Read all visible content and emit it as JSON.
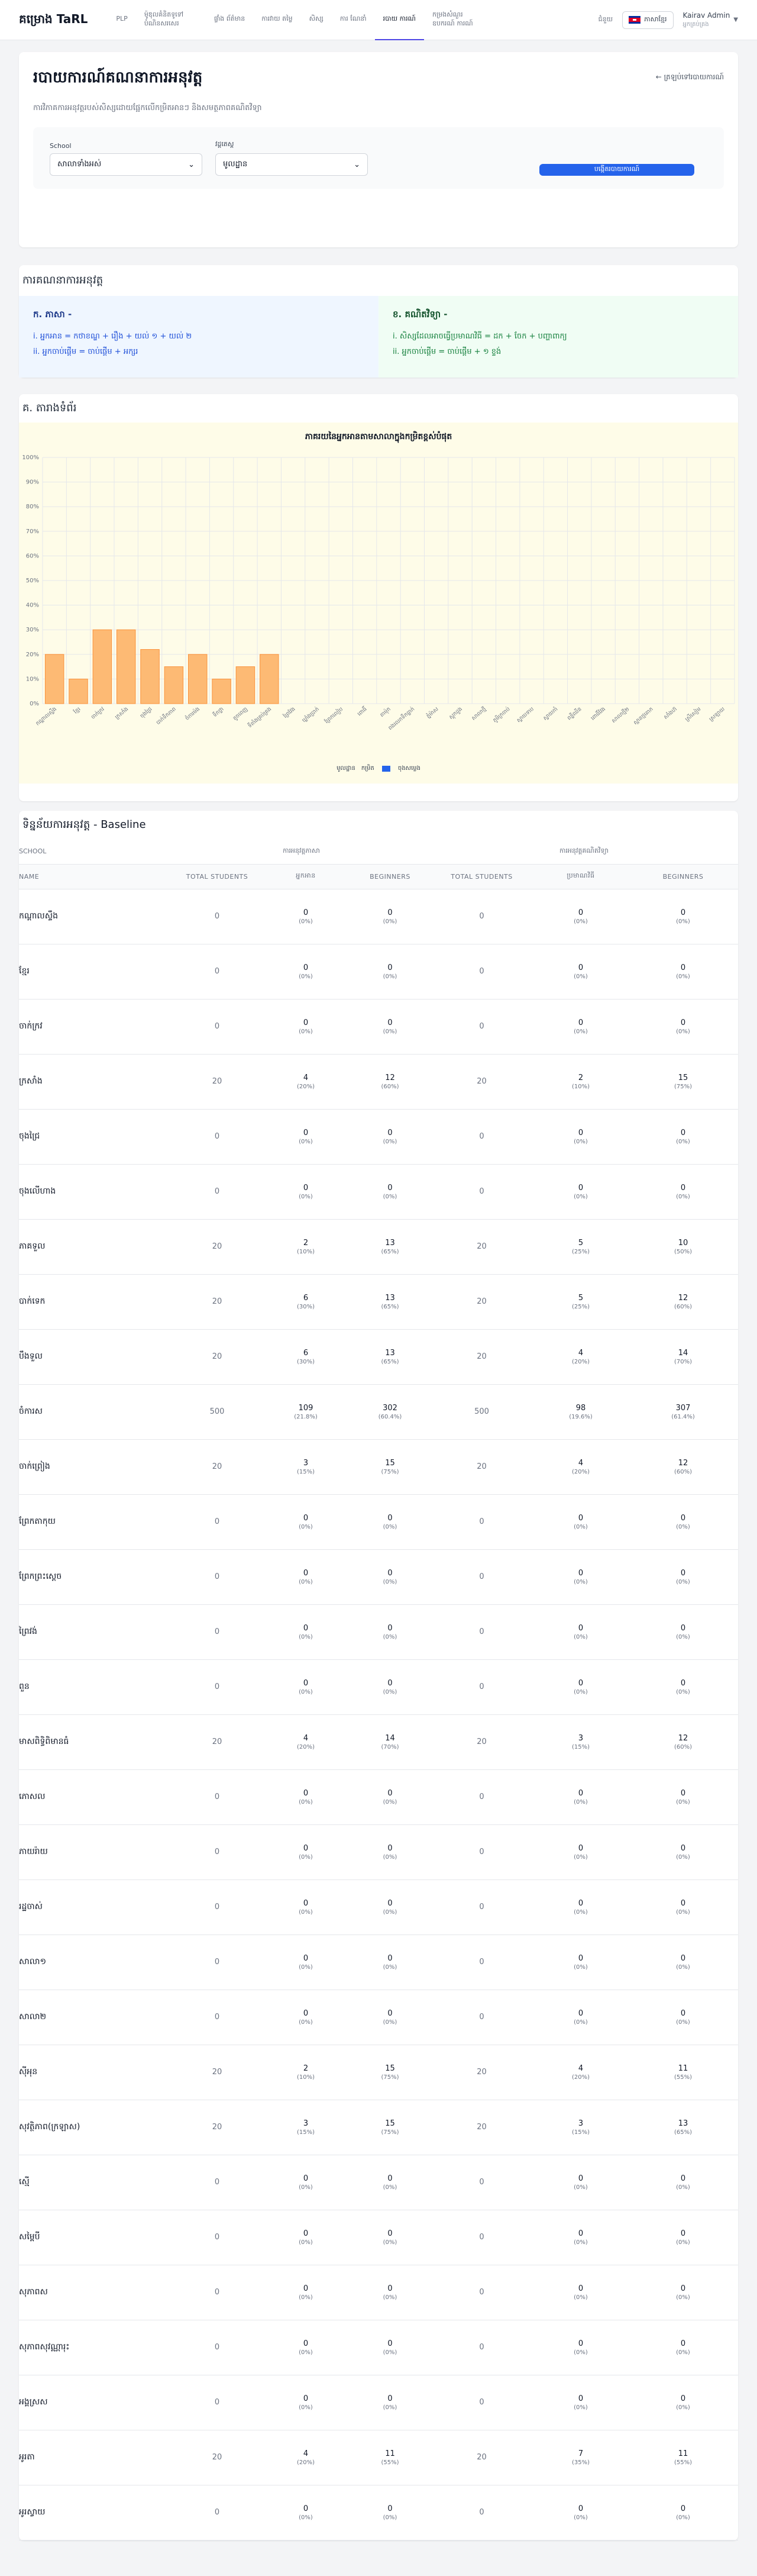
{
  "nav": {
    "brand": "គម្រោង TaRL",
    "links": [
      {
        "label": "PLP",
        "active": false
      },
      {
        "label": "ម៉ូឌុលគំនិតទូទៅ បំណិនសរសេរ",
        "active": false
      },
      {
        "label": "ផ្ទាំង ព័ត៌មាន",
        "active": false
      },
      {
        "label": "ការវាយ តម្លៃ",
        "active": false
      },
      {
        "label": "សិស្ស",
        "active": false
      },
      {
        "label": "ការ ណែនាំ",
        "active": false
      },
      {
        "label": "របាយ ការណ៍",
        "active": true
      },
      {
        "label": "កម្រងសំណួរ ឧបករណ៍ ការណ៍",
        "active": false
      },
      {
        "label": "ជំនួយ",
        "active": false
      }
    ],
    "language": "ភាសាខ្មែរ",
    "user_name": "Kairav Admin",
    "user_role": "អ្នកគ្រប់គ្រង"
  },
  "header": {
    "title": "របាយការណ៍គណនាការអនុវត្ត",
    "back_link": "← ត្រឡប់ទៅរបាយការណ៍",
    "subtitle": "ការវិភាគការអនុវត្តរបស់សិស្សដោយផ្អែកលើកម្រិតអានៗ និងសមត្ថភាពគណិតវិទ្យា",
    "filters": {
      "school_label": "School",
      "school_value": "សាលាទាំងអស់",
      "cycle_label": "វដ្តតេស្ត",
      "cycle_value": "មូលដ្ឋាន",
      "submit_label": "បង្កើតរបាយការណ៍"
    }
  },
  "assessment": {
    "section_title": "ការគណនាការអនុវត្ត",
    "left": {
      "title": "ក. ភាសា -",
      "items": [
        "i. អ្នកអាន = កថាខណ្ឌ + រឿង + យល់ ១ + យល់ ២",
        "ii. អ្នកចាប់ផ្តើម = ចាប់ផ្តើម + អក្សរ"
      ]
    },
    "right": {
      "title": "ខ. គណិតវិទ្យា -",
      "items": [
        "i. សិស្សដែលអាចធ្វើប្រមាណវិធី = ដក + ចែក + បញ្ហាពាក្យ",
        "ii. អ្នកចាប់ផ្តើម = ចាប់ផ្តើម + ១ ខ្ទង់"
      ]
    }
  },
  "chart_section_title": "គ. តារាងទំព័រ",
  "chart_data": {
    "type": "bar",
    "title": "ភាគរយនៃអ្នកអានតាមសាលាក្នុងកម្រិតខ្ពស់បំផុត",
    "categories": [
      "កណ្តាលស្ទឹង",
      "ខ្មែរ",
      "ចាក់ក្រវ",
      "ក្រសាំង",
      "ចុងជ្រៃ",
      "បាក់ទឹកភាព",
      "ចំការម៉ង",
      "ទឹកថ្លា",
      "តូចពេញ",
      "ទីតាំងគ្រប់គ្រង",
      "ព្រៃវែង",
      "ឃ្លាំងប្រាក់",
      "ព្រែកលៀប",
      "ពោធិ៍",
      "តាម៉ុក",
      "ពងរលកទឹកធ្លាក់",
      "ភ្នំម៉ាស",
      "ស្តុកដួង",
      "សាលាថ្មី",
      "ភូមិក្រចាប់",
      "ស្វាយទាប",
      "ស្វាយកាំ",
      "ពន្លឺឈឺន",
      "ពោធិ៍វែង",
      "សាលាថ្មី២",
      "ស្ពានថ្មគោក",
      "សាំងហ៊",
      "ស្រីសៀម",
      "ស្រឡាយ"
    ],
    "values": [
      20,
      10,
      30,
      30,
      22,
      15,
      20,
      10,
      15,
      20,
      0,
      0,
      0,
      0,
      0,
      0,
      0,
      0,
      0,
      0,
      0,
      0,
      0,
      0,
      0,
      0,
      0,
      0,
      0
    ],
    "ylim": [
      0,
      100
    ],
    "yticks": [
      "0%",
      "10%",
      "20%",
      "30%",
      "40%",
      "50%",
      "60%",
      "70%",
      "80%",
      "90%",
      "100%"
    ],
    "grid": true,
    "colors": {
      "bar": "#fdba74",
      "bar_border": "#fb923c",
      "legend2": "#2563eb"
    },
    "legend": [
      "មូលដ្ឋាន",
      "កម្រិត",
      "ចុងសម្លេង"
    ]
  },
  "table": {
    "title": "ទិន្នន័យការអនុវត្ត - Baseline",
    "group_headers": {
      "school": "SCHOOL",
      "khmer": "ការអនុវត្តភាសា",
      "math": "ការអនុវត្តគណិតវិទ្យា"
    },
    "headers": {
      "name": "NAME",
      "total1": "TOTAL STUDENTS",
      "readers": "អ្នកអាន",
      "beginners1": "BEGINNERS",
      "total2": "TOTAL STUDENTS",
      "math_cap": "ប្រមាណវិធី",
      "beginners2": "BEGINNERS"
    },
    "rows": [
      {
        "name": "កណ្តាលស្ទឹង",
        "t1": "0",
        "r": "0",
        "rp": "(0%)",
        "b1": "0",
        "b1p": "(0%)",
        "t2": "0",
        "m": "0",
        "mp": "(0%)",
        "b2": "0",
        "b2p": "(0%)"
      },
      {
        "name": "ខ្មែរ",
        "t1": "0",
        "r": "0",
        "rp": "(0%)",
        "b1": "0",
        "b1p": "(0%)",
        "t2": "0",
        "m": "0",
        "mp": "(0%)",
        "b2": "0",
        "b2p": "(0%)"
      },
      {
        "name": "ចាក់ក្រវ",
        "t1": "0",
        "r": "0",
        "rp": "(0%)",
        "b1": "0",
        "b1p": "(0%)",
        "t2": "0",
        "m": "0",
        "mp": "(0%)",
        "b2": "0",
        "b2p": "(0%)"
      },
      {
        "name": "ក្រសាំង",
        "t1": "20",
        "r": "4",
        "rp": "(20%)",
        "b1": "12",
        "b1p": "(60%)",
        "t2": "20",
        "m": "2",
        "mp": "(10%)",
        "b2": "15",
        "b2p": "(75%)"
      },
      {
        "name": "ចុងជ្រៃ",
        "t1": "0",
        "r": "0",
        "rp": "(0%)",
        "b1": "0",
        "b1p": "(0%)",
        "t2": "0",
        "m": "0",
        "mp": "(0%)",
        "b2": "0",
        "b2p": "(0%)"
      },
      {
        "name": "ចុងលើហាង",
        "t1": "0",
        "r": "0",
        "rp": "(0%)",
        "b1": "0",
        "b1p": "(0%)",
        "t2": "0",
        "m": "0",
        "mp": "(0%)",
        "b2": "0",
        "b2p": "(0%)"
      },
      {
        "name": "ភាគទួល",
        "t1": "20",
        "r": "2",
        "rp": "(10%)",
        "b1": "13",
        "b1p": "(65%)",
        "t2": "20",
        "m": "5",
        "mp": "(25%)",
        "b2": "10",
        "b2p": "(50%)"
      },
      {
        "name": "បាក់ទេក",
        "t1": "20",
        "r": "6",
        "rp": "(30%)",
        "b1": "13",
        "b1p": "(65%)",
        "t2": "20",
        "m": "5",
        "mp": "(25%)",
        "b2": "12",
        "b2p": "(60%)"
      },
      {
        "name": "បឹងទួល",
        "t1": "20",
        "r": "6",
        "rp": "(30%)",
        "b1": "13",
        "b1p": "(65%)",
        "t2": "20",
        "m": "4",
        "mp": "(20%)",
        "b2": "14",
        "b2p": "(70%)"
      },
      {
        "name": "ចំការស",
        "t1": "500",
        "r": "109",
        "rp": "(21.8%)",
        "b1": "302",
        "b1p": "(60.4%)",
        "t2": "500",
        "m": "98",
        "mp": "(19.6%)",
        "b2": "307",
        "b2p": "(61.4%)"
      },
      {
        "name": "ចាក់ព្រៀង",
        "t1": "20",
        "r": "3",
        "rp": "(15%)",
        "b1": "15",
        "b1p": "(75%)",
        "t2": "20",
        "m": "4",
        "mp": "(20%)",
        "b2": "12",
        "b2p": "(60%)"
      },
      {
        "name": "ព្រែកតាកុយ",
        "t1": "0",
        "r": "0",
        "rp": "(0%)",
        "b1": "0",
        "b1p": "(0%)",
        "t2": "0",
        "m": "0",
        "mp": "(0%)",
        "b2": "0",
        "b2p": "(0%)"
      },
      {
        "name": "ព្រែកព្រះស្តេច",
        "t1": "0",
        "r": "0",
        "rp": "(0%)",
        "b1": "0",
        "b1p": "(0%)",
        "t2": "0",
        "m": "0",
        "mp": "(0%)",
        "b2": "0",
        "b2p": "(0%)"
      },
      {
        "name": "ព្រៃវង់",
        "t1": "0",
        "r": "0",
        "rp": "(0%)",
        "b1": "0",
        "b1p": "(0%)",
        "t2": "0",
        "m": "0",
        "mp": "(0%)",
        "b2": "0",
        "b2p": "(0%)"
      },
      {
        "name": "ពួន",
        "t1": "0",
        "r": "0",
        "rp": "(0%)",
        "b1": "0",
        "b1p": "(0%)",
        "t2": "0",
        "m": "0",
        "mp": "(0%)",
        "b2": "0",
        "b2p": "(0%)"
      },
      {
        "name": "មាសពិទ្ធិពិមានធំ",
        "t1": "20",
        "r": "4",
        "rp": "(20%)",
        "b1": "14",
        "b1p": "(70%)",
        "t2": "20",
        "m": "3",
        "mp": "(15%)",
        "b2": "12",
        "b2p": "(60%)"
      },
      {
        "name": "ភោសល",
        "t1": "0",
        "r": "0",
        "rp": "(0%)",
        "b1": "0",
        "b1p": "(0%)",
        "t2": "0",
        "m": "0",
        "mp": "(0%)",
        "b2": "0",
        "b2p": "(0%)"
      },
      {
        "name": "ភាយរ៉ាយ",
        "t1": "0",
        "r": "0",
        "rp": "(0%)",
        "b1": "0",
        "b1p": "(0%)",
        "t2": "0",
        "m": "0",
        "mp": "(0%)",
        "b2": "0",
        "b2p": "(0%)"
      },
      {
        "name": "រដ្ឋចាស់",
        "t1": "0",
        "r": "0",
        "rp": "(0%)",
        "b1": "0",
        "b1p": "(0%)",
        "t2": "0",
        "m": "0",
        "mp": "(0%)",
        "b2": "0",
        "b2p": "(0%)"
      },
      {
        "name": "សាលា១",
        "t1": "0",
        "r": "0",
        "rp": "(0%)",
        "b1": "0",
        "b1p": "(0%)",
        "t2": "0",
        "m": "0",
        "mp": "(0%)",
        "b2": "0",
        "b2p": "(0%)"
      },
      {
        "name": "សាលា២",
        "t1": "0",
        "r": "0",
        "rp": "(0%)",
        "b1": "0",
        "b1p": "(0%)",
        "t2": "0",
        "m": "0",
        "mp": "(0%)",
        "b2": "0",
        "b2p": "(0%)"
      },
      {
        "name": "សុីអុន",
        "t1": "20",
        "r": "2",
        "rp": "(10%)",
        "b1": "15",
        "b1p": "(75%)",
        "t2": "20",
        "m": "4",
        "mp": "(20%)",
        "b2": "11",
        "b2p": "(55%)"
      },
      {
        "name": "សុវត្ថិភាព(ក្រឡាស)",
        "t1": "20",
        "r": "3",
        "rp": "(15%)",
        "b1": "15",
        "b1p": "(75%)",
        "t2": "20",
        "m": "3",
        "mp": "(15%)",
        "b2": "13",
        "b2p": "(65%)"
      },
      {
        "name": "ស្មើ",
        "t1": "0",
        "r": "0",
        "rp": "(0%)",
        "b1": "0",
        "b1p": "(0%)",
        "t2": "0",
        "m": "0",
        "mp": "(0%)",
        "b2": "0",
        "b2p": "(0%)"
      },
      {
        "name": "សម្ពៃបី",
        "t1": "0",
        "r": "0",
        "rp": "(0%)",
        "b1": "0",
        "b1p": "(0%)",
        "t2": "0",
        "m": "0",
        "mp": "(0%)",
        "b2": "0",
        "b2p": "(0%)"
      },
      {
        "name": "សុភាពស",
        "t1": "0",
        "r": "0",
        "rp": "(0%)",
        "b1": "0",
        "b1p": "(0%)",
        "t2": "0",
        "m": "0",
        "mp": "(0%)",
        "b2": "0",
        "b2p": "(0%)"
      },
      {
        "name": "សុភាពសុវណ្ណារុះ",
        "t1": "0",
        "r": "0",
        "rp": "(0%)",
        "b1": "0",
        "b1p": "(0%)",
        "t2": "0",
        "m": "0",
        "mp": "(0%)",
        "b2": "0",
        "b2p": "(0%)"
      },
      {
        "name": "អង្គស្រស",
        "t1": "0",
        "r": "0",
        "rp": "(0%)",
        "b1": "0",
        "b1p": "(0%)",
        "t2": "0",
        "m": "0",
        "mp": "(0%)",
        "b2": "0",
        "b2p": "(0%)"
      },
      {
        "name": "អូរតា",
        "t1": "20",
        "r": "4",
        "rp": "(20%)",
        "b1": "11",
        "b1p": "(55%)",
        "t2": "20",
        "m": "7",
        "mp": "(35%)",
        "b2": "11",
        "b2p": "(55%)"
      },
      {
        "name": "អូរស្វាយ",
        "t1": "0",
        "r": "0",
        "rp": "(0%)",
        "b1": "0",
        "b1p": "(0%)",
        "t2": "0",
        "m": "0",
        "mp": "(0%)",
        "b2": "0",
        "b2p": "(0%)"
      }
    ]
  }
}
